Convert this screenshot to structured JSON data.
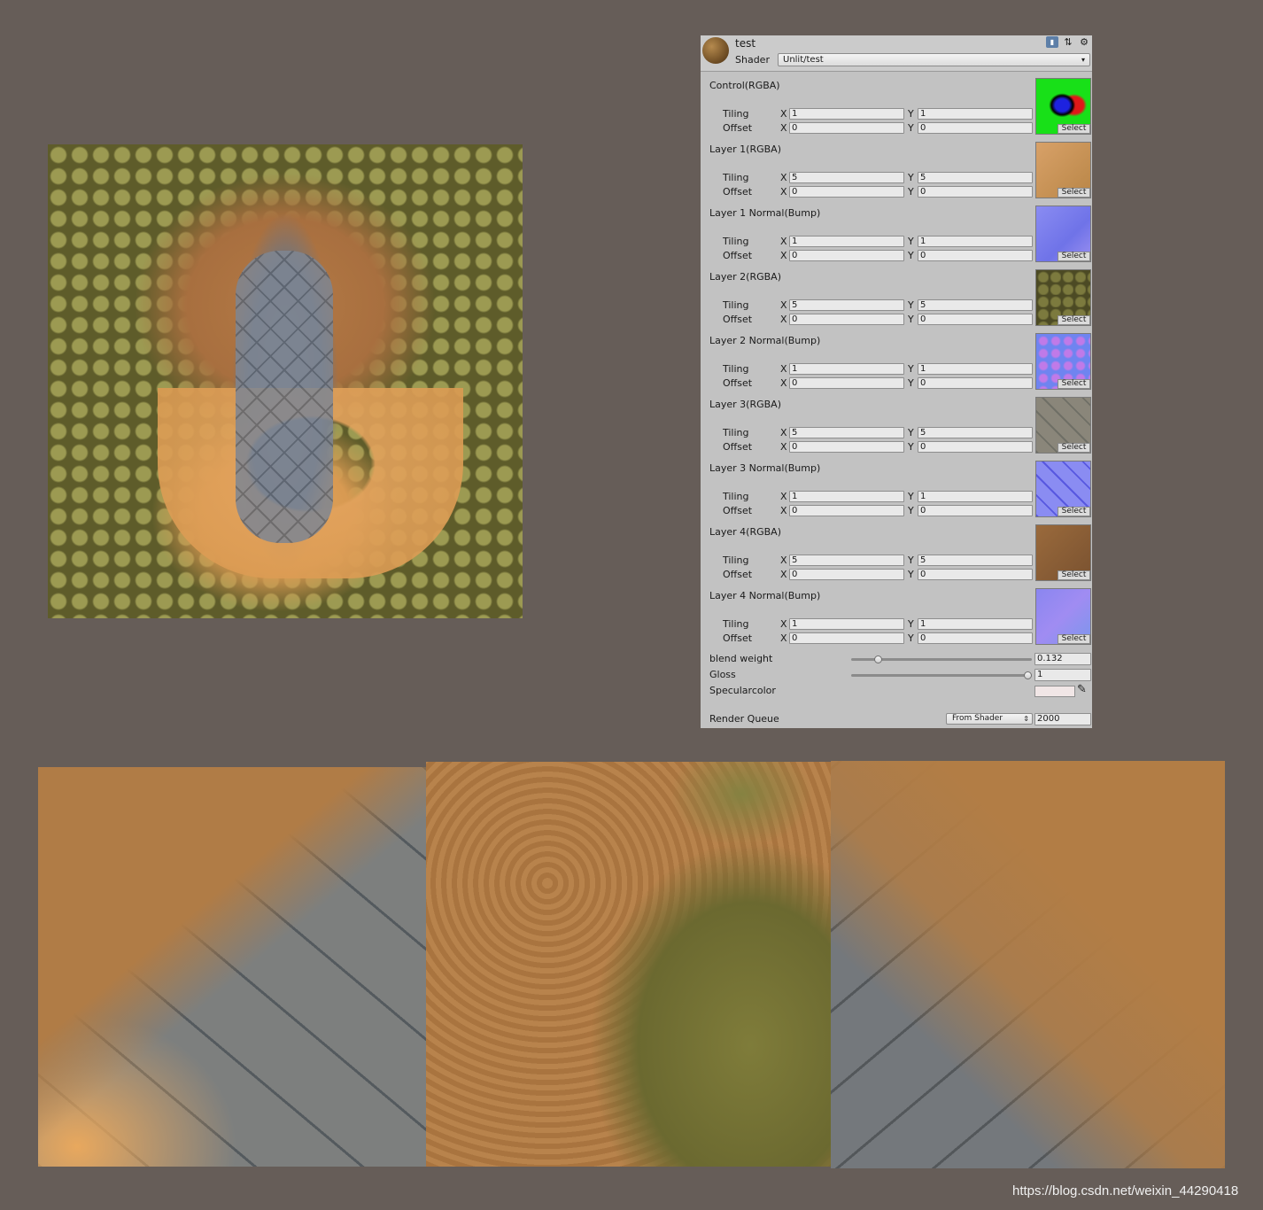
{
  "inspector": {
    "material_name": "test",
    "shader_label": "Shader",
    "shader_value": "Unlit/test",
    "tiling_label": "Tiling",
    "offset_label": "Offset",
    "axis_x": "X",
    "axis_y": "Y",
    "select_label": "Select",
    "properties": [
      {
        "title": "Control(RGBA)",
        "tiling_x": "1",
        "tiling_y": "1",
        "offset_x": "0",
        "offset_y": "0"
      },
      {
        "title": "Layer 1(RGBA)",
        "tiling_x": "5",
        "tiling_y": "5",
        "offset_x": "0",
        "offset_y": "0"
      },
      {
        "title": "Layer 1 Normal(Bump)",
        "tiling_x": "1",
        "tiling_y": "1",
        "offset_x": "0",
        "offset_y": "0"
      },
      {
        "title": "Layer 2(RGBA)",
        "tiling_x": "5",
        "tiling_y": "5",
        "offset_x": "0",
        "offset_y": "0"
      },
      {
        "title": "Layer 2 Normal(Bump)",
        "tiling_x": "1",
        "tiling_y": "1",
        "offset_x": "0",
        "offset_y": "0"
      },
      {
        "title": "Layer 3(RGBA)",
        "tiling_x": "5",
        "tiling_y": "5",
        "offset_x": "0",
        "offset_y": "0"
      },
      {
        "title": "Layer 3 Normal(Bump)",
        "tiling_x": "1",
        "tiling_y": "1",
        "offset_x": "0",
        "offset_y": "0"
      },
      {
        "title": "Layer 4(RGBA)",
        "tiling_x": "5",
        "tiling_y": "5",
        "offset_x": "0",
        "offset_y": "0"
      },
      {
        "title": "Layer 4 Normal(Bump)",
        "tiling_x": "1",
        "tiling_y": "1",
        "offset_x": "0",
        "offset_y": "0"
      }
    ],
    "blend_weight": {
      "label": "blend weight",
      "value": "0.132",
      "slider_fraction": 0.132
    },
    "gloss": {
      "label": "Gloss",
      "value": "1",
      "slider_fraction": 1.0
    },
    "specular": {
      "label": "Specularcolor",
      "color": "#f1e6e6"
    },
    "render_queue": {
      "label": "Render Queue",
      "mode": "From Shader",
      "value": "2000"
    },
    "icons": [
      "book-icon",
      "layout-icon",
      "settings-icon",
      "eyedropper-icon"
    ]
  },
  "watermark": "https://blog.csdn.net/weixin_44290418"
}
